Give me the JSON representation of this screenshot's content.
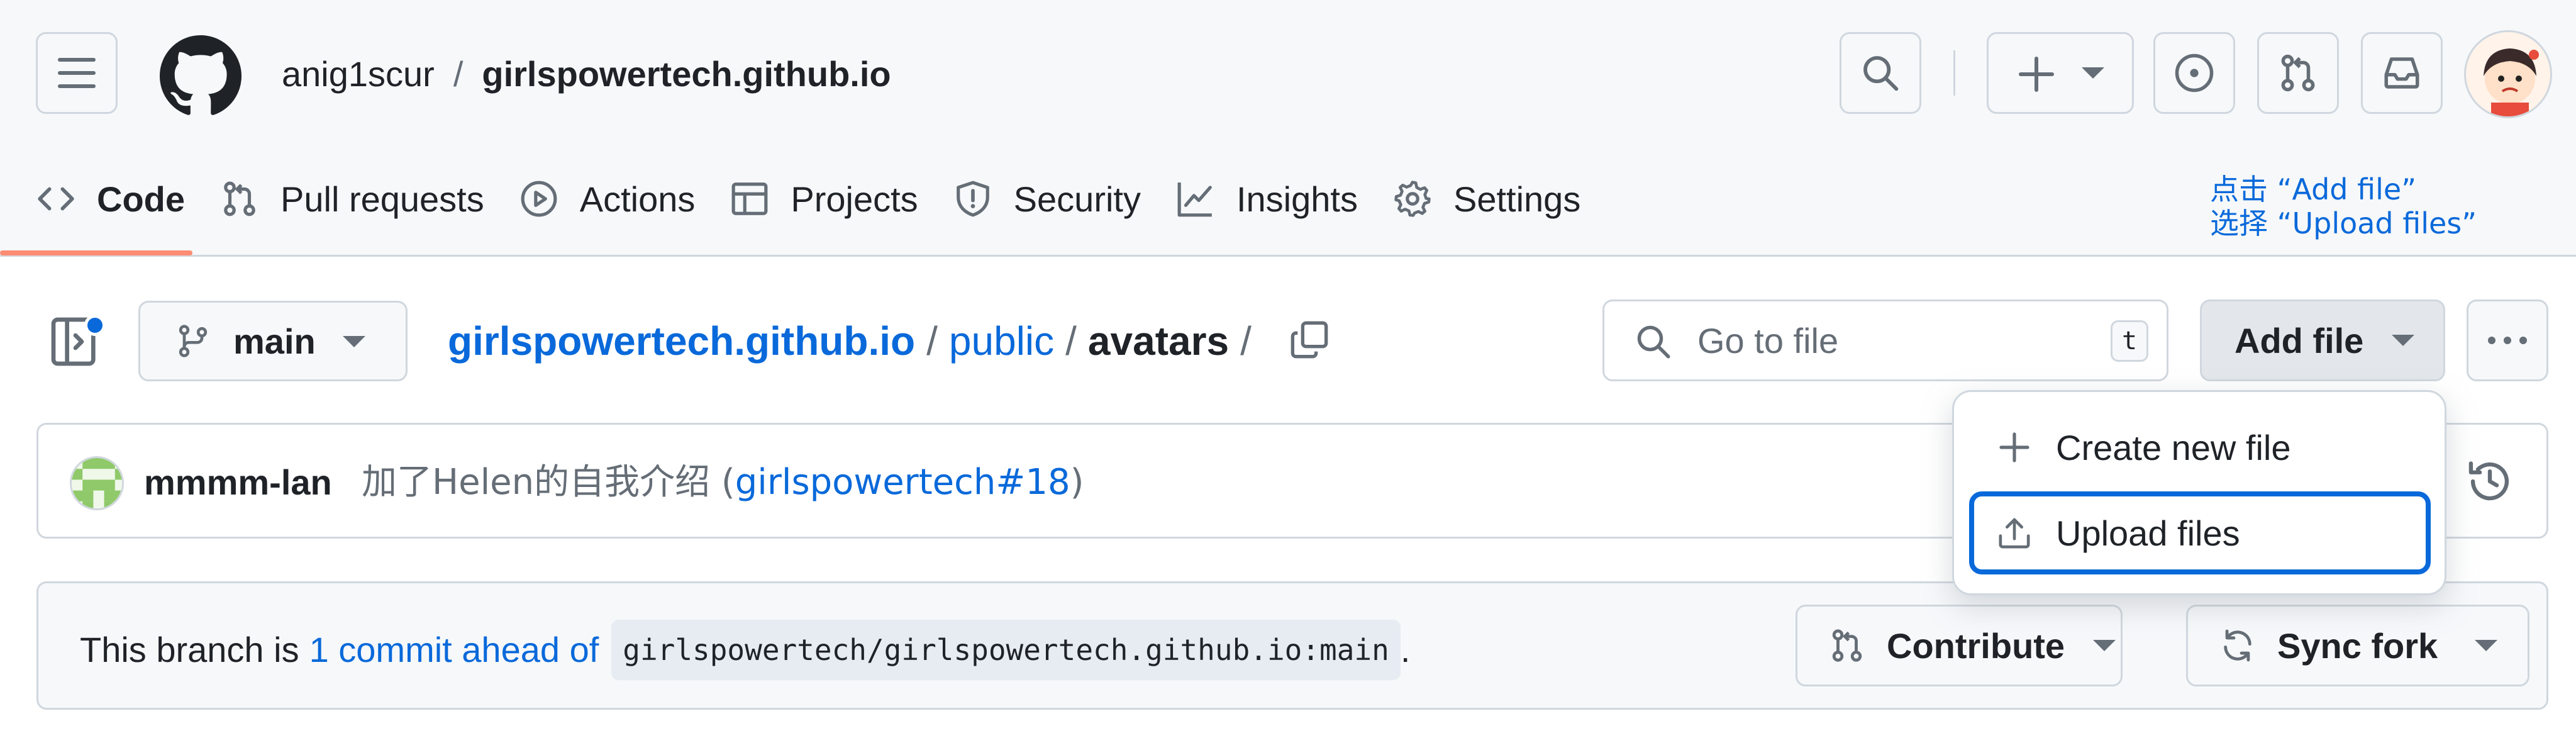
{
  "header": {
    "owner": "anig1scur",
    "separator": "/",
    "repo_name": "girlspowertech.github.io"
  },
  "tabs": [
    {
      "label": "Code",
      "icon": "code-icon"
    },
    {
      "label": "Pull requests",
      "icon": "git-pull-request-icon"
    },
    {
      "label": "Actions",
      "icon": "play-circle-icon"
    },
    {
      "label": "Projects",
      "icon": "table-icon"
    },
    {
      "label": "Security",
      "icon": "shield-icon"
    },
    {
      "label": "Insights",
      "icon": "graph-icon"
    },
    {
      "label": "Settings",
      "icon": "gear-icon"
    }
  ],
  "annotation": {
    "line1": "点击 “Add file”",
    "line2": "选择 “Upload files”"
  },
  "toolbar": {
    "branch": "main",
    "path_root": "girlspowertech.github.io",
    "path_sep": "/",
    "path_folder": "public",
    "path_current": "avatars",
    "goto_placeholder": "Go to file",
    "goto_shortcut": "t",
    "add_file_label": "Add file"
  },
  "commit": {
    "author": "mmmm-lan",
    "message": "加了Helen的自我介绍",
    "ref_open": "(",
    "ref": "girlspowertech#18",
    "ref_close": ")"
  },
  "branch_status": {
    "prefix": "This branch is",
    "ahead": "1 commit ahead of",
    "upstream": "girlspowertech/girlspowertech.github.io:main",
    "suffix": ".",
    "contribute_label": "Contribute",
    "sync_label": "Sync fork"
  },
  "dropdown": {
    "items": [
      {
        "label": "Create new file",
        "icon": "plus-icon"
      },
      {
        "label": "Upload files",
        "icon": "upload-icon"
      }
    ]
  },
  "colors": {
    "accent": "#0969da",
    "tab_underline": "#fd8c73",
    "border": "#d0d7de"
  }
}
